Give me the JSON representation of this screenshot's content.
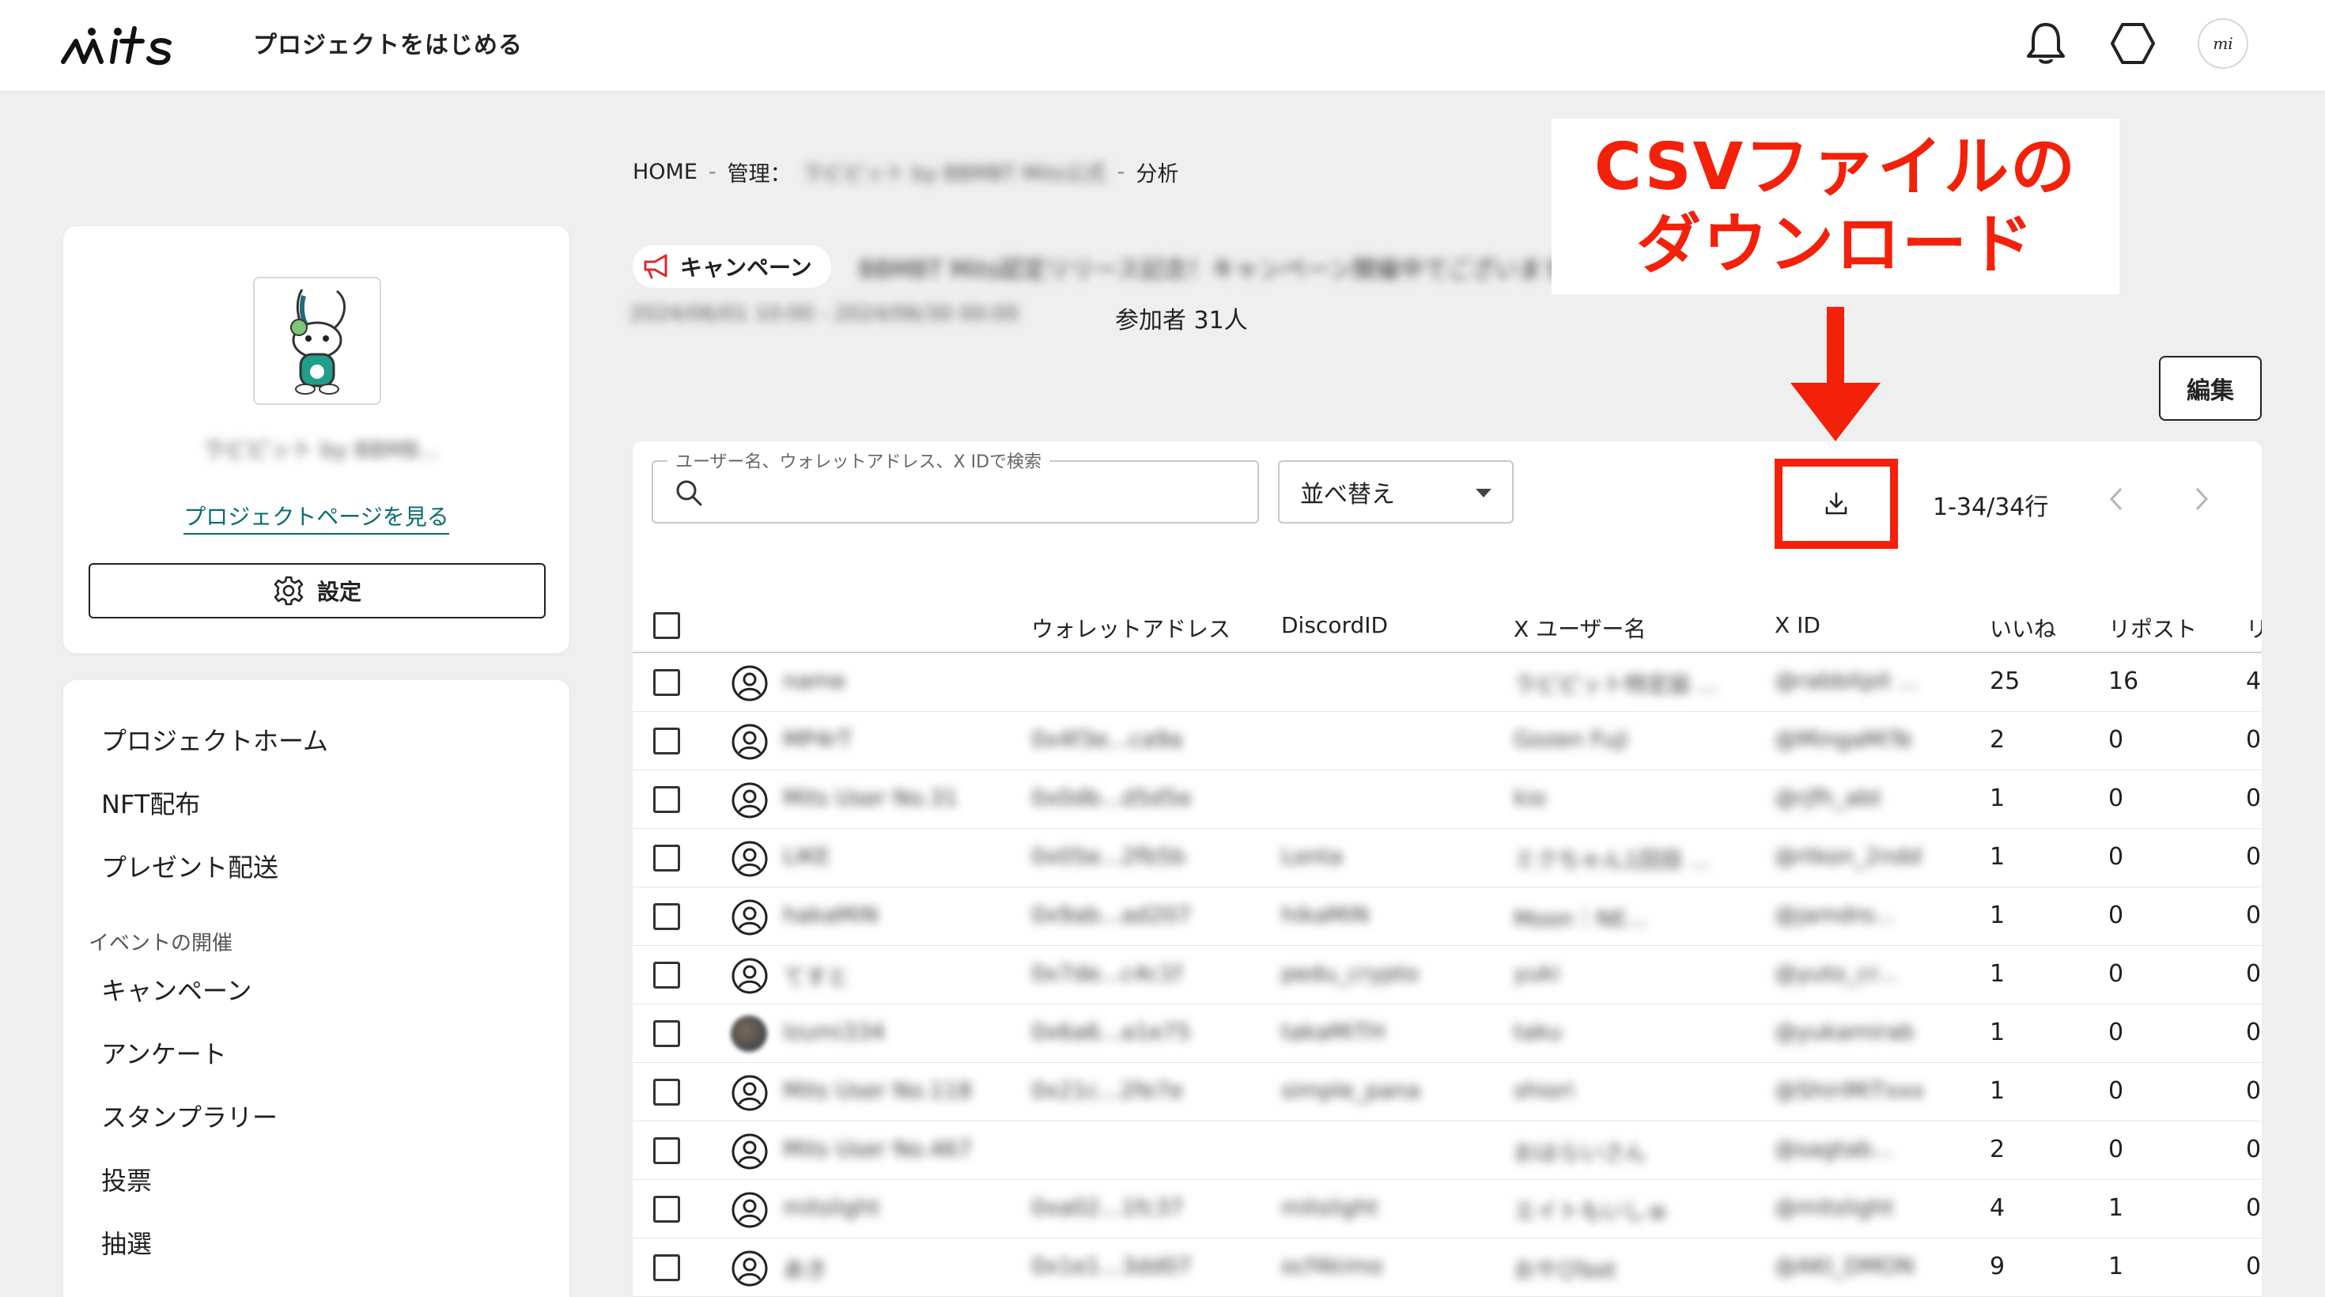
{
  "header": {
    "logo_text": "mits",
    "title": "プロジェクトをはじめる",
    "avatar_text": "mi"
  },
  "sidebar": {
    "project_name": "ラビピット by BBMB...",
    "project_link": "プロジェクトページを見る",
    "settings_label": "設定",
    "menu": [
      {
        "label": "プロジェクトホーム"
      },
      {
        "label": "NFT配布"
      },
      {
        "label": "プレゼント配送"
      }
    ],
    "section_title": "イベントの開催",
    "event_menu": [
      {
        "label": "キャンペーン"
      },
      {
        "label": "アンケート"
      },
      {
        "label": "スタンプラリー"
      },
      {
        "label": "投票"
      },
      {
        "label": "抽選"
      }
    ]
  },
  "breadcrumb": {
    "home": "HOME",
    "admin": "管理：",
    "admin_blur": "ラビピット by BBMBT Mits公式",
    "sep": "-",
    "current": "分析"
  },
  "campaign": {
    "chip_label": "キャンペーン",
    "title_blur": "BBMBT Mits認定リリース記念！キャンペーン開催中でございます",
    "period_blur": "2024/06/01 10:00 - 2024/06/30 00:00",
    "participants": "参加者 31人"
  },
  "edit_label": "編集",
  "annotation": {
    "line1": "CSVファイルの",
    "line2": "ダウンロード",
    "color": "#f3200a"
  },
  "toolbar": {
    "search_legend": "ユーザー名、ウォレットアドレス、X IDで検索",
    "search_value": "",
    "sort_label": "並べ替え",
    "pager_text": "1-34/34行"
  },
  "table": {
    "columns": [
      "ウォレットアドレス",
      "DiscordID",
      "X ユーザー名",
      "X ID",
      "いいね",
      "リポスト",
      "リ"
    ],
    "rows": [
      {
        "name": "name",
        "wallet": "",
        "discord": "",
        "xname": "ラビピット特定設 ...",
        "xid": "@rabbitpit ...",
        "likes": "25",
        "reposts": "16",
        "more": "4",
        "photo": false
      },
      {
        "name": "MP4rT",
        "wallet": "0x4f3e...ca9a",
        "discord": "",
        "xname": "Gozen Fuji",
        "xid": "@MingaMiTe",
        "likes": "2",
        "reposts": "0",
        "more": "0",
        "photo": false
      },
      {
        "name": "Mits User No.31",
        "wallet": "0x0db...d5d5e",
        "discord": "",
        "xname": "kio",
        "xid": "@rjfh_abt",
        "likes": "1",
        "reposts": "0",
        "more": "0",
        "photo": false
      },
      {
        "name": "LIKE",
        "wallet": "0x05e...2fb5b",
        "discord": "Lonta",
        "xname": "ミクちゃん1回目 ...",
        "xid": "@rtkon_2ndd",
        "likes": "1",
        "reposts": "0",
        "more": "0",
        "photo": false
      },
      {
        "name": "hakaMiN",
        "wallet": "0x9ab...ad207",
        "discord": "hikaMiN",
        "xname": "Moon｜NE...",
        "xid": "@jamdro...",
        "likes": "1",
        "reposts": "0",
        "more": "0",
        "photo": false
      },
      {
        "name": "てすと",
        "wallet": "0x7de...c4c1f",
        "discord": "pedu_crypto",
        "xname": "yuki",
        "xid": "@yuto_cr...",
        "likes": "1",
        "reposts": "0",
        "more": "0",
        "photo": false
      },
      {
        "name": "Izumi334",
        "wallet": "0x6a6...a1e75",
        "discord": "takaMiTH",
        "xname": "taku",
        "xid": "@yukamirab",
        "likes": "1",
        "reposts": "0",
        "more": "0",
        "photo": true
      },
      {
        "name": "Mits User No.118",
        "wallet": "0x21c...2fe7e",
        "discord": "simple_pana",
        "xname": "shiori",
        "xid": "@ShiriMiTxxx",
        "likes": "1",
        "reposts": "0",
        "more": "0",
        "photo": false
      },
      {
        "name": "Mits User No.467",
        "wallet": "",
        "discord": "",
        "xname": "おはらいさん",
        "xid": "@sagtab...",
        "likes": "2",
        "reposts": "0",
        "more": "0",
        "photo": false
      },
      {
        "name": "mitslight",
        "wallet": "0xa02...1fc37",
        "discord": "mitslight",
        "xname": "エイトもいしゅ",
        "xid": "@mitslight",
        "likes": "4",
        "reposts": "1",
        "more": "0",
        "photo": false
      },
      {
        "name": "あき",
        "wallet": "0x1e1...3dd07",
        "discord": "ocf4kimo",
        "xname": "おやびbot",
        "xid": "@AKI_DMON",
        "likes": "9",
        "reposts": "1",
        "more": "0",
        "photo": false
      }
    ]
  }
}
